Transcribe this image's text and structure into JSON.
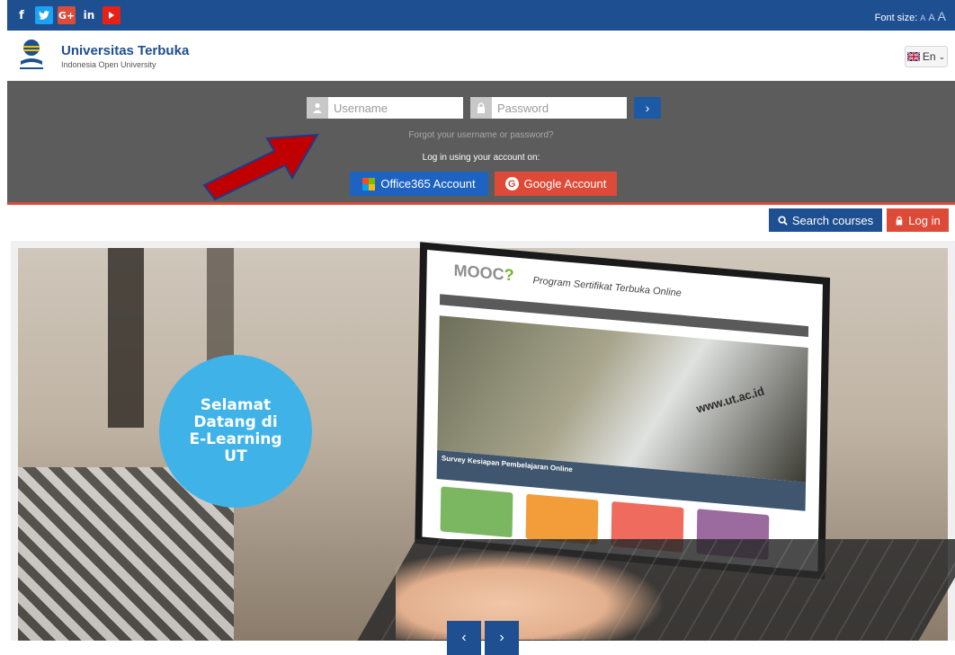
{
  "topbar": {
    "social": [
      {
        "name": "facebook",
        "glyph": "f"
      },
      {
        "name": "twitter",
        "glyph": "t"
      },
      {
        "name": "google-plus",
        "glyph": "G+"
      },
      {
        "name": "linkedin",
        "glyph": "in"
      },
      {
        "name": "youtube",
        "glyph": ""
      }
    ],
    "font_size_label": "Font size:",
    "font_sizes": [
      "A",
      "A",
      "A"
    ]
  },
  "header": {
    "brand_name": "Universitas Terbuka",
    "brand_sub": "Indonesia Open University",
    "language": "En"
  },
  "login": {
    "username_placeholder": "Username",
    "password_placeholder": "Password",
    "submit_glyph": "›",
    "forgot_link": "Forgot your username or password?",
    "login_via": "Log in using your account on:",
    "office365": "Office365 Account",
    "google": "Google Account"
  },
  "actions": {
    "search_courses": "Search courses",
    "log_in": "Log in"
  },
  "slider": {
    "welcome": "Selamat\nDatang di\nE-Learning\nUT",
    "screen": {
      "brand": "MOOC",
      "title": "Program Sertifikat Terbuka Online",
      "url_text": "www.ut.ac.id",
      "band_title": "Survey Kesiapan Pembelajaran Online"
    },
    "prev": "‹",
    "next": "›"
  },
  "colors": {
    "primary": "#1d4f91",
    "accent": "#de4a38",
    "loginbar": "#5c5c5c",
    "welcome": "#3fb3e8"
  }
}
